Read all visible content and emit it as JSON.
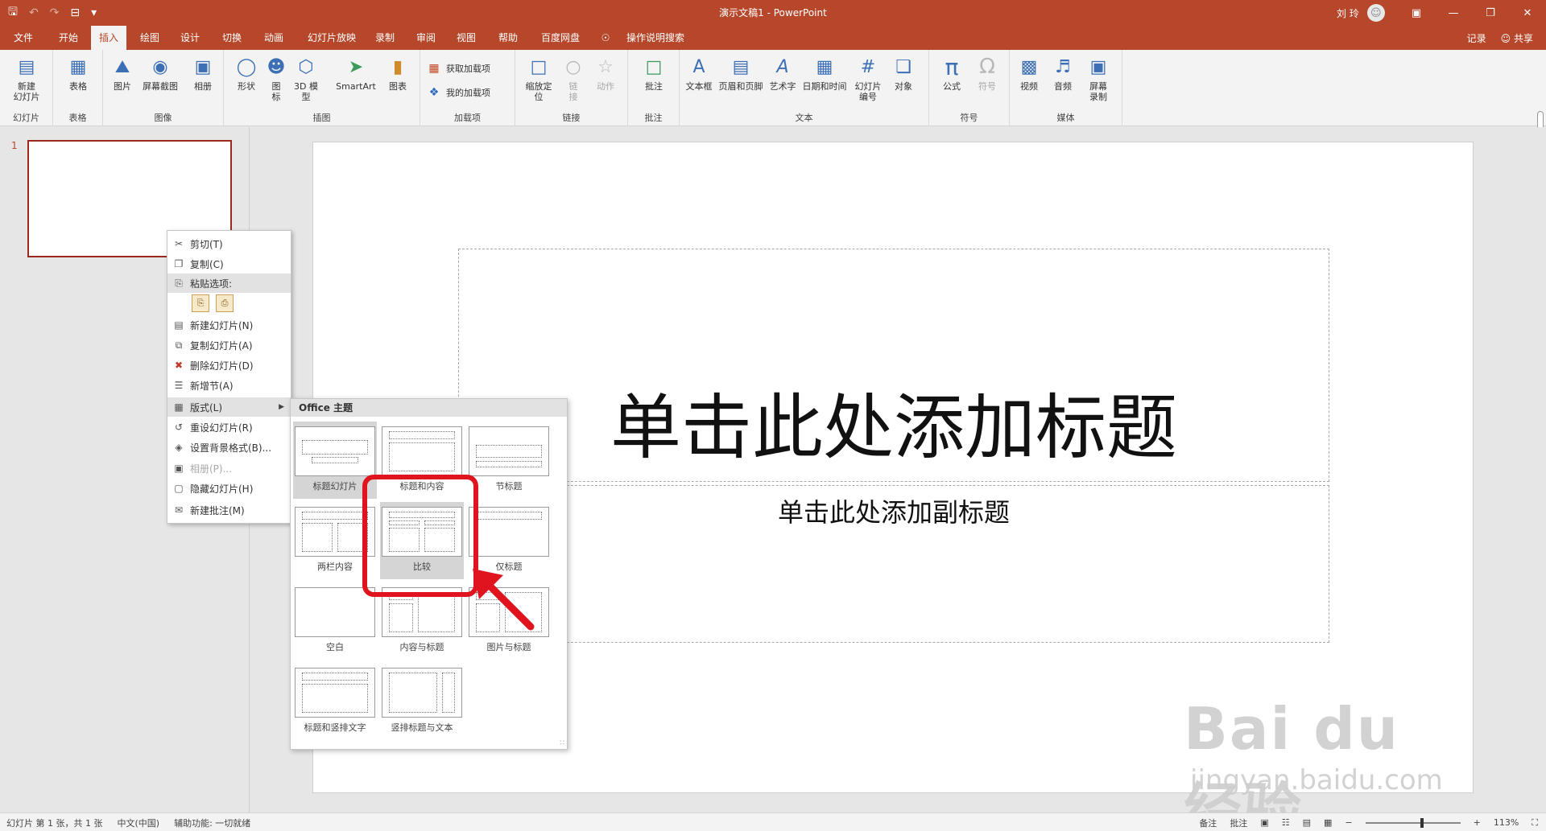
{
  "window": {
    "doc_title": "演示文稿1 - PowerPoint",
    "user_name": "刘 玲",
    "user_avatar": "☺",
    "qat": [
      "🖫",
      "↶",
      "↷",
      "⊟",
      "▾"
    ],
    "win_buttons": [
      "▣",
      "—",
      "❐",
      "✕"
    ]
  },
  "menu": {
    "tabs": [
      "文件",
      "开始",
      "插入",
      "绘图",
      "设计",
      "切换",
      "动画",
      "幻灯片放映",
      "录制",
      "审阅",
      "视图",
      "帮助",
      "百度网盘",
      "操作说明搜索"
    ],
    "active_tab": "插入",
    "search_icon": "☉",
    "record": "记录",
    "share": "共享",
    "share_icon": "☺"
  },
  "ribbon": {
    "groups": {
      "slides": "幻灯片",
      "tables": "表格",
      "images": "图像",
      "illustrations": "插图",
      "addins": "加载项",
      "links": "链接",
      "comments": "批注",
      "text": "文本",
      "symbols": "符号",
      "media": "媒体"
    },
    "buttons": {
      "new_slide": "新建\n幻灯片",
      "table": "表格",
      "picture": "图片",
      "screenshot": "屏幕截图",
      "album": "相册",
      "shapes": "形状",
      "icons": "图\n标",
      "model3d": "3D 模\n型",
      "smartart": "SmartArt",
      "chart": "图表",
      "get_addins": "获取加载项",
      "my_addins": "我的加载项",
      "zoom": "缩放定\n位",
      "link": "链\n接",
      "action": "动作",
      "comment": "批注",
      "textbox": "文本框",
      "header_footer": "页眉和页脚",
      "wordart": "艺术字",
      "datetime": "日期和时间",
      "slide_number": "幻灯片\n编号",
      "object": "对象",
      "equation": "公式",
      "symbol": "符号",
      "video": "视频",
      "audio": "音频",
      "screen_record": "屏幕\n录制"
    }
  },
  "thumbnails": {
    "slide_number": "1"
  },
  "slide": {
    "title_placeholder": "单击此处添加标题",
    "subtitle_placeholder": "单击此处添加副标题"
  },
  "context_menu": {
    "items": [
      {
        "label": "剪切(T)",
        "icon": "✂"
      },
      {
        "label": "复制(C)",
        "icon": "❐"
      },
      {
        "label": "粘贴选项:",
        "icon": "⎘"
      },
      {
        "label": "新建幻灯片(N)",
        "icon": "▤"
      },
      {
        "label": "复制幻灯片(A)",
        "icon": "⧉"
      },
      {
        "label": "删除幻灯片(D)",
        "icon": "✖"
      },
      {
        "label": "新增节(A)",
        "icon": "☰"
      },
      {
        "label": "版式(L)",
        "icon": "▦"
      },
      {
        "label": "重设幻灯片(R)",
        "icon": "↺"
      },
      {
        "label": "设置背景格式(B)...",
        "icon": "◈"
      },
      {
        "label": "相册(P)...",
        "icon": "▣"
      },
      {
        "label": "隐藏幻灯片(H)",
        "icon": "▢"
      },
      {
        "label": "新建批注(M)",
        "icon": "✉"
      }
    ],
    "paste_icons": [
      "⎘",
      "⎙"
    ],
    "submenu_arrow": "▶"
  },
  "layout_menu": {
    "header": "Office 主题",
    "layouts": [
      "标题幻灯片",
      "标题和内容",
      "节标题",
      "两栏内容",
      "比较",
      "仅标题",
      "空白",
      "内容与标题",
      "图片与标题",
      "标题和竖排文字",
      "竖排标题与文本"
    ],
    "selected": "比较",
    "grip": "∷"
  },
  "statusbar": {
    "slide_info": "幻灯片 第 1 张，共 1 张",
    "language": "中文(中国)",
    "accessibility": "辅助功能: 一切就绪",
    "notes": "备注",
    "comments": "批注",
    "view_icons": [
      "▣",
      "☷",
      "▤",
      "▦"
    ],
    "zoom_minus": "−",
    "zoom_plus": "+",
    "zoom_level": "113%",
    "fit_icon": "⛶"
  },
  "watermark": {
    "logo_text": "Bai du 经验",
    "url": "jingyan.baidu.com"
  },
  "colors": {
    "accent": "#b7472a",
    "highlight_red": "#e0141e"
  }
}
